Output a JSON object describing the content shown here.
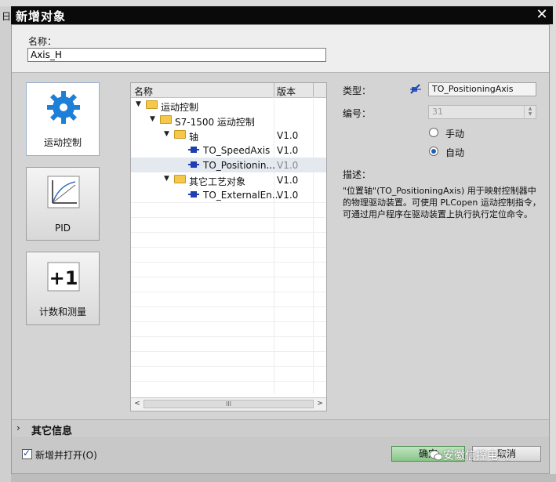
{
  "window": {
    "title": "新增对象",
    "close": "✕"
  },
  "background": {
    "left_char": "日"
  },
  "name_field": {
    "label": "名称：",
    "value": "Axis_H"
  },
  "categories": [
    {
      "label": "运动控制",
      "icon": "gear-icon",
      "selected": true
    },
    {
      "label": "PID",
      "icon": "pid-chart-icon",
      "selected": false
    },
    {
      "label": "计数和测量",
      "icon": "plus-one-icon",
      "badge": "+1",
      "selected": false
    }
  ],
  "tree": {
    "col_name": "名称",
    "col_version": "版本",
    "rows": [
      {
        "name": "运动控制",
        "version": "",
        "level": 0,
        "kind": "folder"
      },
      {
        "name": "S7-1500 运动控制",
        "version": "",
        "level": 1,
        "kind": "folder"
      },
      {
        "name": "轴",
        "version": "V1.0",
        "level": 2,
        "kind": "folder"
      },
      {
        "name": "TO_SpeedAxis",
        "version": "V1.0",
        "level": 3,
        "kind": "object"
      },
      {
        "name": "TO_Positionin...",
        "version": "V1.0",
        "level": 3,
        "kind": "object",
        "highlight": true
      },
      {
        "name": "其它工艺对象",
        "version": "V1.0",
        "level": 2,
        "kind": "folder"
      },
      {
        "name": "TO_ExternalEn...",
        "version": "V1.0",
        "level": 3,
        "kind": "object"
      }
    ],
    "scroll_left": "<",
    "scroll_right": ">",
    "scroll_thumb": "III"
  },
  "details": {
    "type_label": "类型：",
    "type_value": "TO_PositioningAxis",
    "number_label": "编号：",
    "number_value": "31",
    "radio_manual": "手动",
    "radio_auto": "自动",
    "selected_mode": "auto",
    "desc_label": "描述：",
    "description": "\"位置轴\"(TO_PositioningAxis) 用于映射控制器中的物理驱动装置。可使用 PLCopen 运动控制指令，可通过用户程序在驱动装置上执行执行定位命令。"
  },
  "more_info": {
    "label": "其它信息"
  },
  "footer": {
    "add_open_label": "新增并打开(O)",
    "add_open_checked": true,
    "ok_label": "确定",
    "cancel_label": "取消"
  },
  "watermark": {
    "text": "安徽信控电气"
  },
  "colors": {
    "titlebar": "#0a0a0a",
    "selection": "#e4e8ef",
    "ok_button": "#89c589",
    "accent": "#1f5fb3"
  }
}
